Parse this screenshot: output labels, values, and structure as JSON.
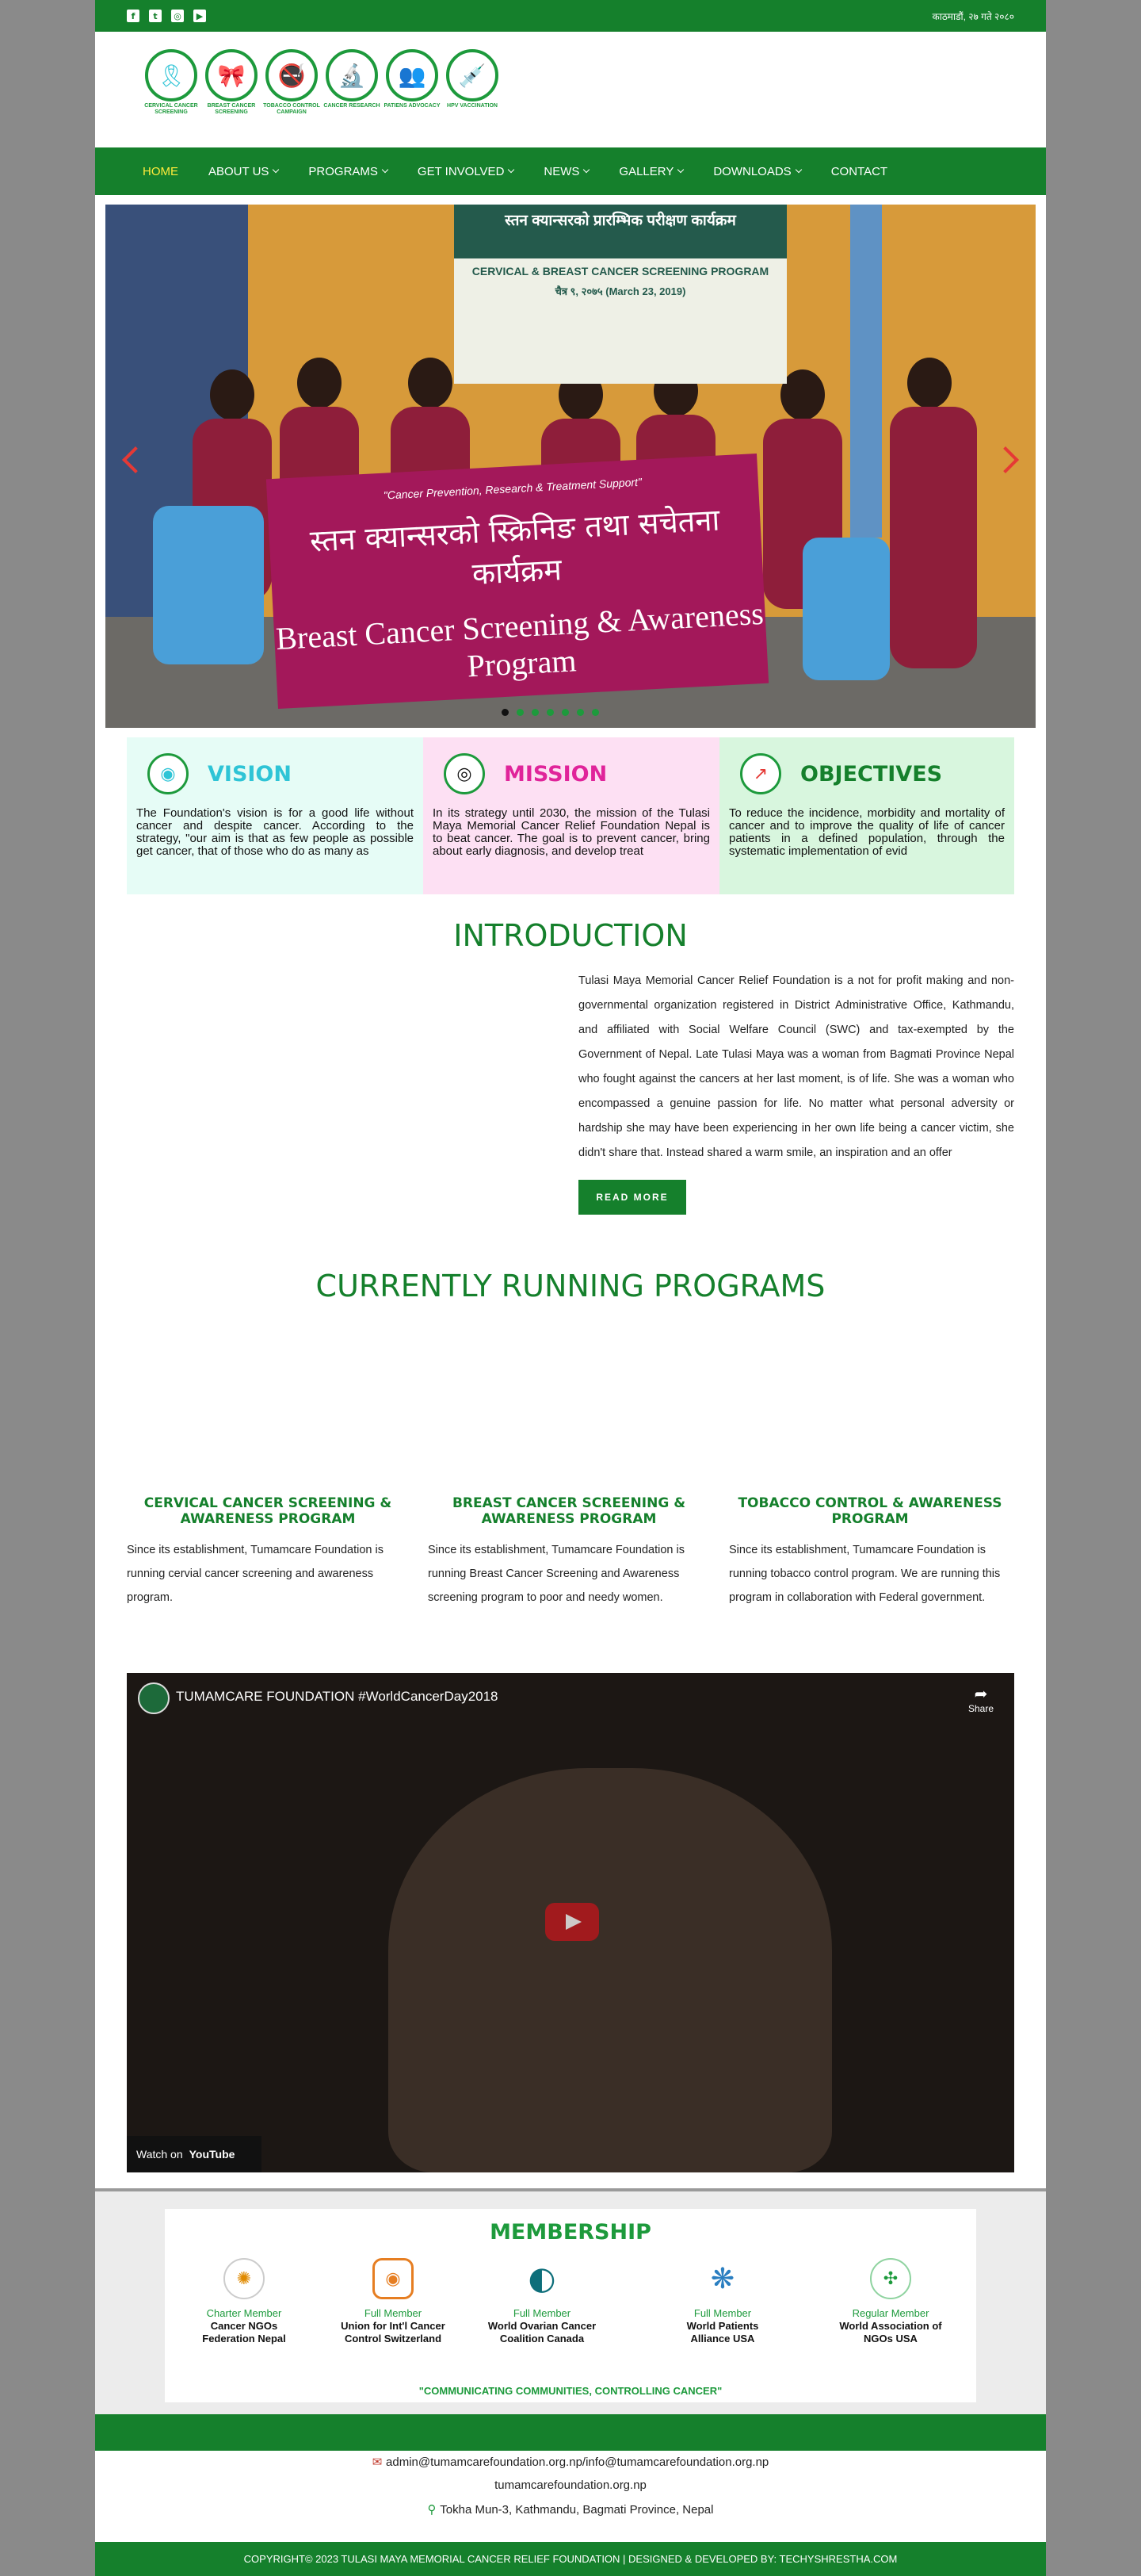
{
  "topbar": {
    "social_icons": [
      "facebook-icon",
      "twitter-icon",
      "instagram-icon",
      "youtube-icon"
    ],
    "right_text": "काठमाडौं, २७ गते २०८०"
  },
  "logos": [
    {
      "label": "CERVICAL CANCER SCREENING",
      "icon": "ribbon-icon",
      "glyph": "🎗"
    },
    {
      "label": "BREAST CANCER SCREENING",
      "icon": "pink-ribbon-icon",
      "glyph": "🎀"
    },
    {
      "label": "TOBACCO CONTROL CAMPAIGN",
      "icon": "no-smoking-icon",
      "glyph": "🚭"
    },
    {
      "label": "CANCER RESEARCH",
      "icon": "research-icon",
      "glyph": "🔬"
    },
    {
      "label": "PATIENS ADVOCACY",
      "icon": "people-icon",
      "glyph": "👥"
    },
    {
      "label": "HPV VACCINATION",
      "icon": "vaccine-icon",
      "glyph": "💉"
    }
  ],
  "nav": [
    {
      "label": "HOME",
      "active": true,
      "dropdown": false
    },
    {
      "label": "ABOUT US",
      "dropdown": true
    },
    {
      "label": "PROGRAMS",
      "dropdown": true
    },
    {
      "label": "GET INVOLVED",
      "dropdown": true
    },
    {
      "label": "NEWS",
      "dropdown": true
    },
    {
      "label": "GALLERY",
      "dropdown": true
    },
    {
      "label": "DOWNLOADS",
      "dropdown": true
    },
    {
      "label": "CONTACT",
      "dropdown": false
    }
  ],
  "slider": {
    "sign_title": "स्तन क्यान्सरको प्रारम्भिक परीक्षण कार्यक्रम",
    "sign_subtitle": "CERVICAL & BREAST CANCER SCREENING PROGRAM",
    "sign_date": "चैत्र ९, २०७५ (March 23, 2019)",
    "banner_tagline": "\"Cancer Prevention, Research & Treatment Support\"",
    "banner_nepali": "स्तन क्यान्सरको स्क्रिनिङ तथा सचेतना कार्यक्रम",
    "banner_english": "Breast Cancer Screening & Awareness Program",
    "dots": 7,
    "active_dot": 0
  },
  "vision": {
    "title": "VISION",
    "icon": "eye-icon",
    "color": "#2ec4d6",
    "bg": "#e6fcf6",
    "text": "The Foundation's vision is for a good life without cancer and despite cancer. According to the strategy, \"our aim is that as few people as possible get cancer, that of those who do as many as"
  },
  "mission": {
    "title": "MISSION",
    "icon": "target-icon",
    "color": "#e0249a",
    "bg": "#fde0f3",
    "text": "In its strategy until 2030, the mission of the Tulasi Maya Memorial Cancer Relief Foundation Nepal is to beat cancer. The goal is to prevent cancer, bring about early diagnosis, and develop treat"
  },
  "objectives": {
    "title": "OBJECTIVES",
    "icon": "chart-up-icon",
    "color": "#15802c",
    "bg": "#d8f6de",
    "text": "To reduce the incidence, morbidity and mortality of cancer and to improve the quality of life of cancer patients in a defined population, through the systematic implementation of evid"
  },
  "intro": {
    "title": "INTRODUCTION",
    "text": "Tulasi Maya Memorial Cancer Relief Foundation is a not for profit making and non-governmental organization registered in District Administrative Office, Kathmandu, and affiliated with Social Welfare Council (SWC) and tax-exempted by the Government of Nepal. Late Tulasi Maya was a woman from Bagmati Province Nepal who fought against the cancers at her last moment, is of life. She was a woman who encompassed a genuine passion for life. No matter what personal adversity or hardship she may have been experiencing in her own life being a cancer victim, she didn't share that. Instead shared a warm smile, an inspiration and an offer",
    "button": "READ MORE"
  },
  "programs": {
    "title": "CURRENTLY RUNNING PROGRAMS",
    "items": [
      {
        "heading": "CERVICAL CANCER SCREENING & AWARENESS PROGRAM",
        "text": "Since its establishment, Tumamcare Foundation is running cervial cancer screening and awareness program."
      },
      {
        "heading": "BREAST CANCER SCREENING & AWARENESS PROGRAM",
        "text": "Since its establishment, Tumamcare Foundation is running Breast Cancer Screening and Awareness screening program to poor and needy women."
      },
      {
        "heading": "TOBACCO CONTROL & AWARENESS PROGRAM",
        "text": "Since its establishment, Tumamcare Foundation is running tobacco control program. We are running this program in collaboration with Federal government."
      }
    ]
  },
  "video": {
    "title": "TUMAMCARE FOUNDATION #WorldCancerDay2018",
    "share": "Share",
    "watch_on": "Watch on",
    "youtube": "YouTube"
  },
  "membership": {
    "title": "MEMBERSHIP",
    "items": [
      {
        "type": "Charter Member",
        "org": "Cancer NGOs Federation Nepal",
        "icon": "cngof-logo-icon",
        "glyph": "✺"
      },
      {
        "type": "Full Member",
        "org": "Union for Int'l Cancer Control Switzerland",
        "icon": "uicc-logo-icon",
        "glyph": "◉"
      },
      {
        "type": "Full Member",
        "org": "World Ovarian Cancer Coalition Canada",
        "icon": "woc-logo-icon",
        "glyph": "◐"
      },
      {
        "type": "Full Member",
        "org": "World Patients Alliance USA",
        "icon": "wpa-logo-icon",
        "glyph": "❋"
      },
      {
        "type": "Regular Member",
        "org": "World Association of NGOs USA",
        "icon": "wango-logo-icon",
        "glyph": "✣"
      }
    ],
    "slogan": "\"COMMUNICATING COMMUNITIES, CONTROLLING CANCER\""
  },
  "footer": {
    "email": "admin@tumamcarefoundation.org.np/info@tumamcarefoundation.org.np",
    "website": "tumamcarefoundation.org.np",
    "address": "Tokha Mun-3, Kathmandu, Bagmati Province, Nepal",
    "copyright": "COPYRIGHT© 2023 TULASI MAYA MEMORIAL CANCER RELIEF FOUNDATION | DESIGNED & DEVELOPED BY: TECHYSHRESTHA.COM"
  }
}
